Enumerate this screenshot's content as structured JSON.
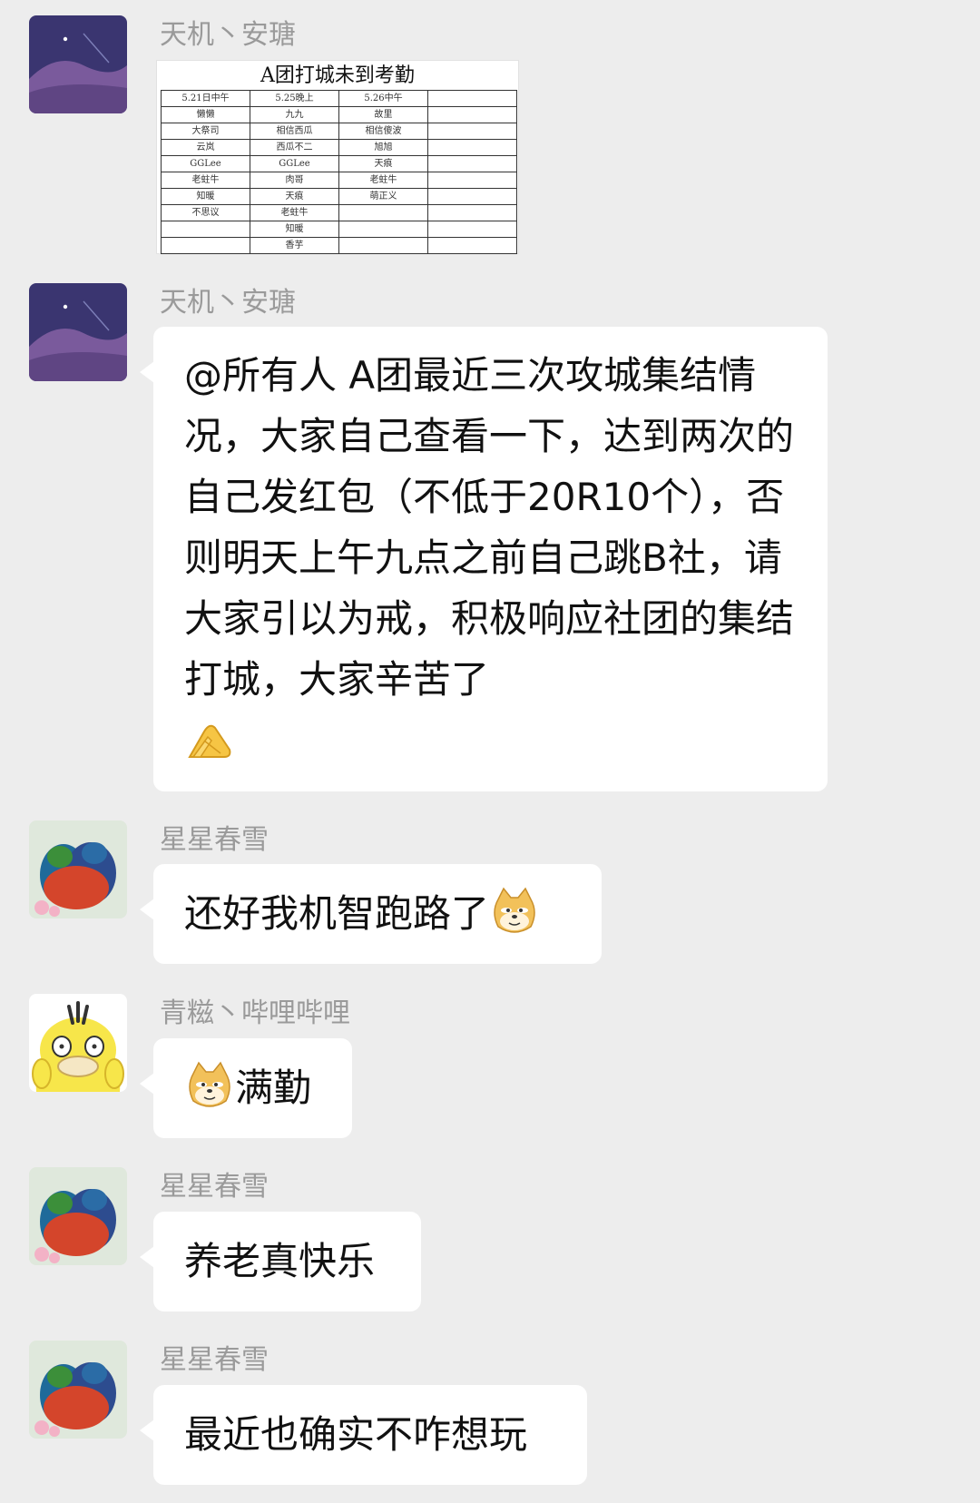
{
  "messages": [
    {
      "sender": "天机丶安瑭",
      "avatar": "night-sky-avatar",
      "attachment": {
        "title": "A团打城未到考勤",
        "headers": [
          "5.21日中午",
          "5.25晚上",
          "5.26中午",
          ""
        ],
        "rows": [
          [
            "懒懒",
            "九九",
            "故里",
            ""
          ],
          [
            "大祭司",
            "相信西瓜",
            "相信傻波",
            ""
          ],
          [
            "云岚",
            "西瓜不二",
            "旭旭",
            ""
          ],
          [
            "GGLee",
            "GGLee",
            "天痕",
            ""
          ],
          [
            "老蛀牛",
            "肉哥",
            "老蛀牛",
            ""
          ],
          [
            "知暖",
            "天痕",
            "萌正义",
            ""
          ],
          [
            "不思议",
            "老蛀牛",
            "",
            ""
          ],
          [
            "",
            "知暖",
            "",
            ""
          ],
          [
            "",
            "香芋",
            "",
            ""
          ]
        ]
      }
    },
    {
      "sender": "天机丶安瑭",
      "avatar": "night-sky-avatar",
      "text": "@所有人 A团最近三次攻城集结情况，大家自己查看一下，达到两次的自己发红包（不低于20R10个），否则明天上午九点之前自己跳B社，请大家引以为戒，积极响应社团的集结打城，大家辛苦了",
      "trailing_emoji": "praying-hands-icon"
    },
    {
      "sender": "星星春雪",
      "avatar": "parrots-avatar",
      "text": "还好我机智跑路了",
      "trailing_emoji": "doge-icon"
    },
    {
      "sender": "青糍丶哔哩哔哩",
      "avatar": "psyduck-avatar",
      "leading_emoji": "doge-icon",
      "text": "满勤"
    },
    {
      "sender": "星星春雪",
      "avatar": "parrots-avatar",
      "text": "养老真快乐"
    },
    {
      "sender": "星星春雪",
      "avatar": "parrots-avatar",
      "text": "最近也确实不咋想玩"
    }
  ],
  "colors": {
    "background": "#ededed",
    "bubble": "#ffffff",
    "sender_name": "#9a9a9a"
  }
}
